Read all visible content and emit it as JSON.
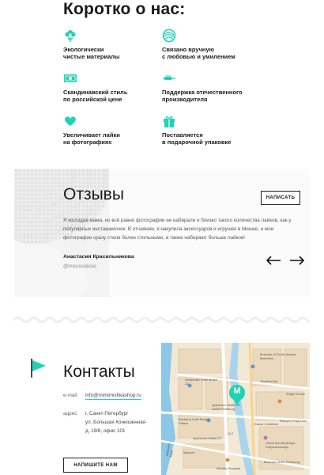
{
  "about": {
    "title": "Коротко о нас:",
    "features": [
      {
        "icon": "flower-icon",
        "text": "Экологически\nчистые материалы"
      },
      {
        "icon": "yarn-ball-icon",
        "text": "Связано вручную\nс любовью и умилением"
      },
      {
        "icon": "banknote-icon",
        "text": "Скандинавский стиль\nпо российской цене"
      },
      {
        "icon": "needle-icon",
        "text": "Поддержка отечественного\nпроизводителя"
      },
      {
        "icon": "heart-icon",
        "text": "Увеличивает лайки\nна фотографиях"
      },
      {
        "icon": "gift-icon",
        "text": "Поставляется\nв подарочной упаковке"
      }
    ]
  },
  "reviews": {
    "title": "Отзывы",
    "write_button": "НАПИСАТЬ",
    "text": "Я молодая мама, но всё равно фотографии не набирали и близко такого количества лайков, как у популярных инстамамочек. В отчаянии, я накупила аксессуаров и игрушек в Мишке, и мои фотографии сразу стали более стильными, а также набирают больше лайков!",
    "author": "Анастасия Красильникова",
    "handle": "@missssiskras",
    "prev_icon": "arrow-left-icon",
    "next_icon": "arrow-right-icon"
  },
  "contacts": {
    "title": "Контакты",
    "email_label": "e-mail:",
    "email": "info@mimimishkashop.ru",
    "address_label": "адрес:",
    "address_lines": [
      "г. Санкт-Петербург",
      "ул. Большая Конюшенная",
      "д. 19/8, офис 101"
    ],
    "cta": "НАПИШИТЕ НАМ",
    "flag_icon": "flag-icon"
  },
  "map": {
    "labels": [
      "Kempinski Hotel Moika 22",
      "Apartment Moika 22 Sankt-Peterburg",
      "Boutique-hotel Moyka Palace",
      "Museum of Soviet Arcade Machines",
      "Buddha-Bar",
      "Zinger House",
      "DLT",
      "Apartment Moika 22",
      "Street food Bolshaya Konyushennaya",
      "Nevsky Prospekt",
      "Museum of the Peterburg",
      "Mariinsky Most",
      "Manezh",
      "Kazan Cathedral",
      "Eliseyev Emporium"
    ],
    "marker": "M"
  },
  "colors": {
    "accent": "#1fd3b4",
    "text": "#1a1a1a",
    "muted": "#888888"
  }
}
